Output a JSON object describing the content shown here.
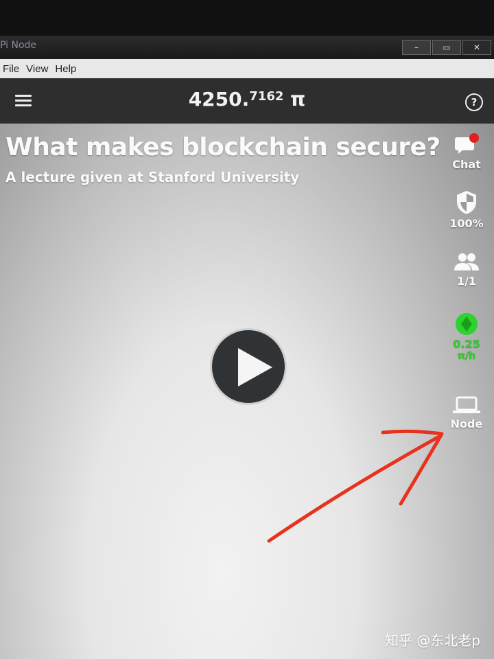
{
  "window": {
    "title": "Pi Node",
    "controls": {
      "minimize": "–",
      "maximize": "▭",
      "close": "✕"
    }
  },
  "menu": {
    "items": [
      "File",
      "View",
      "Help"
    ]
  },
  "header": {
    "balance_int": "4250.",
    "balance_frac": "7162",
    "currency": "π"
  },
  "video": {
    "title": "What makes blockchain secure?",
    "subtitle": "A lecture given at Stanford University"
  },
  "sidebar": {
    "chat_label": "Chat",
    "security_label": "100%",
    "team_label": "1/1",
    "mining_rate": "0.25",
    "mining_unit": "π/h",
    "node_label": "Node"
  },
  "colors": {
    "mining_green": "#2fd12f",
    "notification_red": "#e02020",
    "arrow_red": "#e8321e"
  },
  "watermark": "知乎 @东北老p"
}
